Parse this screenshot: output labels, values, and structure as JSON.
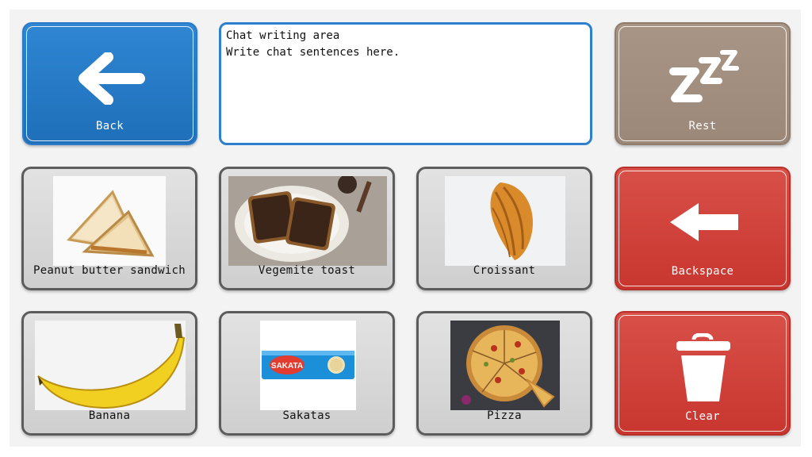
{
  "nav": {
    "back_label": "Back",
    "rest_label": "Rest",
    "backspace_label": "Backspace",
    "clear_label": "Clear"
  },
  "chat": {
    "line1": "Chat writing area",
    "line2": "Write chat sentences here."
  },
  "items": [
    {
      "label": "Peanut butter sandwich",
      "icon": "sandwich-image"
    },
    {
      "label": "Vegemite toast",
      "icon": "toast-image"
    },
    {
      "label": "Croissant",
      "icon": "croissant-image"
    },
    {
      "label": "Banana",
      "icon": "banana-image"
    },
    {
      "label": "Sakatas",
      "icon": "sakatas-image"
    },
    {
      "label": "Pizza",
      "icon": "pizza-image"
    }
  ],
  "sakatas_pack_text": "SAKATA",
  "colors": {
    "back": "#2f86d3",
    "rest": "#a89585",
    "danger": "#d0433c",
    "food_tile": "#d8d8d8"
  }
}
